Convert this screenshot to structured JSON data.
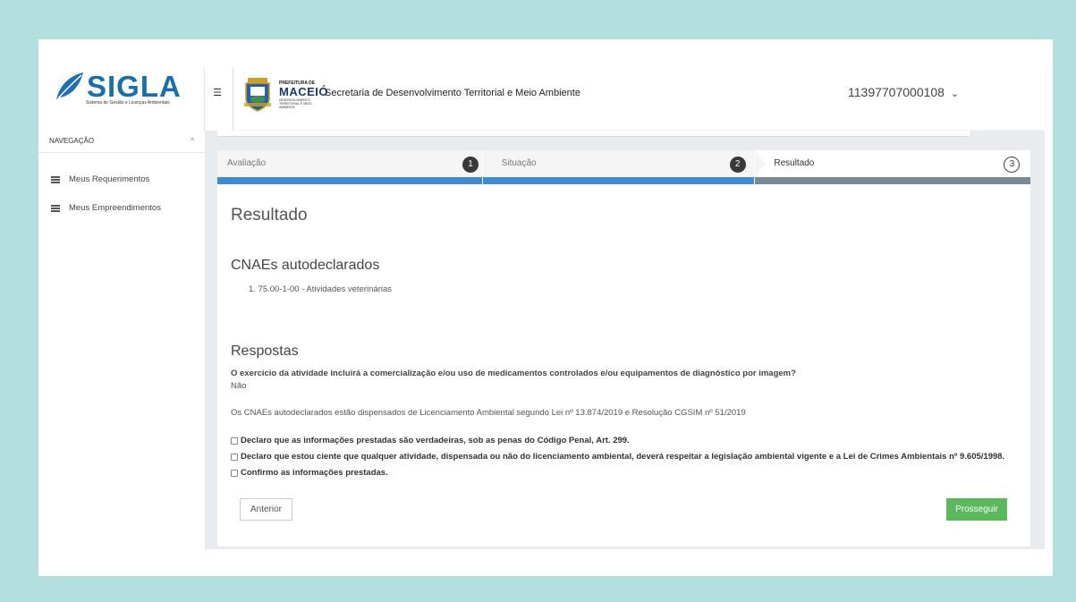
{
  "brand": {
    "name": "SIGLA",
    "subtitle": "Sistema de Gestão e Licenças Ambientais"
  },
  "header": {
    "prefeitura_top": "PREFEITURA DE",
    "prefeitura_city": "MACEIÓ",
    "prefeitura_sub": "DESENVOLVIMENTO TERRITORIAL E MEIO AMBIENTE",
    "title": "Secretaria de Desenvolvimento Territorial e Meio Ambiente",
    "user": "11397707000108",
    "user_caret": "⌄"
  },
  "sidebar": {
    "section": "NAVEGAÇÃO",
    "caret": "^",
    "items": [
      {
        "label": "Meus Requerimentos"
      },
      {
        "label": "Meus Empreendimentos"
      }
    ]
  },
  "wizard": {
    "steps": [
      {
        "label": "Avaliação",
        "number": "1",
        "bar_color": "#428bca"
      },
      {
        "label": "Situação",
        "number": "2",
        "bar_color": "#428bca"
      },
      {
        "label": "Resultado",
        "number": "3",
        "bar_color": "#7a8a94"
      }
    ]
  },
  "content": {
    "title": "Resultado",
    "cnaes_heading": "CNAEs autodeclarados",
    "cnaes": [
      "1. 75.00-1-00 - Atividades veterinárias"
    ],
    "respostas_heading": "Respostas",
    "question": "O exercício da atividade incluirá a comercialização e/ou uso de medicamentos controlados e/ou equipamentos de diagnóstico por imagem?",
    "answer": "Não",
    "note": "Os CNAEs autodeclarados estão dispensados de Licenciamento Ambiental segundo Lei nº 13.874/2019 e Resolução CGSIM nº 51/2019",
    "checks": [
      "Declaro que as informações prestadas são verdadeiras, sob as penas do Código Penal, Art. 299.",
      "Declaro que estou ciente que qualquer atividade, dispensada ou não do licenciamento ambiental, deverá respeitar a legislação ambiental vigente e a Lei de Crimes Ambientais nº 9.605/1998.",
      "Confirmo as informações prestadas."
    ],
    "prev_button": "Anterior",
    "next_button": "Prosseguir"
  },
  "colors": {
    "brand_blue": "#1a6fa8",
    "leaf": "#1f6fb0",
    "step_blue": "#428bca",
    "success": "#5cb85c"
  }
}
